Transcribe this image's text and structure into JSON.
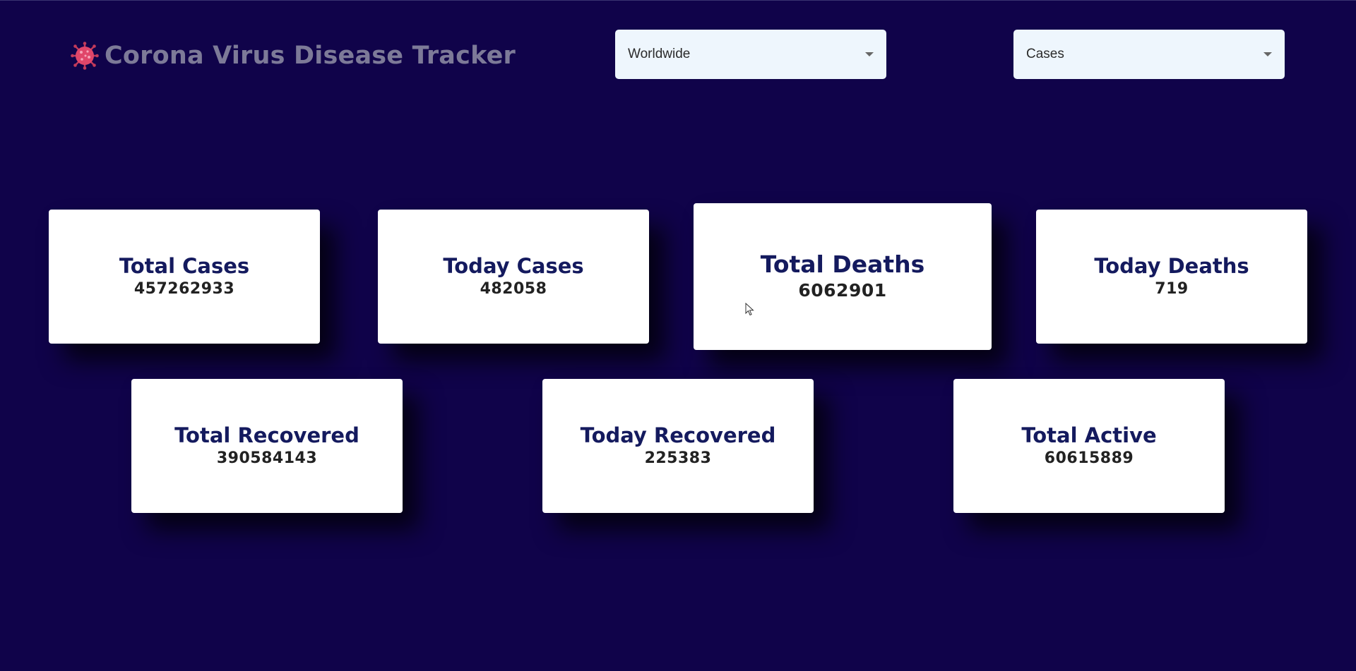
{
  "header": {
    "title": "Corona Virus Disease Tracker",
    "icon": "virus-icon",
    "icon_color": "#e0466a"
  },
  "filters": {
    "region": {
      "value": "Worldwide"
    },
    "metric": {
      "value": "Cases"
    }
  },
  "stats": [
    {
      "label": "Total Cases",
      "value": "457262933"
    },
    {
      "label": "Today Cases",
      "value": "482058"
    },
    {
      "label": "Total Deaths",
      "value": "6062901"
    },
    {
      "label": "Today Deaths",
      "value": "719"
    },
    {
      "label": "Total Recovered",
      "value": "390584143"
    },
    {
      "label": "Today Recovered",
      "value": "225383"
    },
    {
      "label": "Total Active",
      "value": "60615889"
    }
  ],
  "colors": {
    "background": "#10034a",
    "card_title": "#141a5e",
    "select_bg": "#eef6fd"
  }
}
